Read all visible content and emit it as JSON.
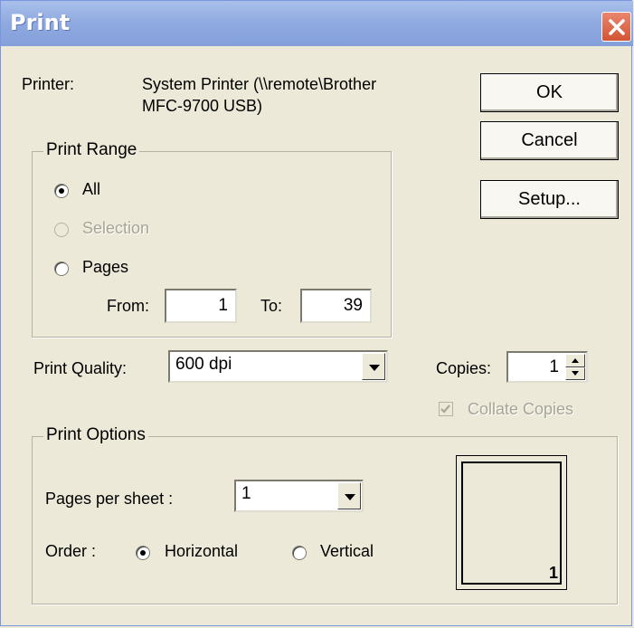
{
  "window": {
    "title": "Print"
  },
  "printer": {
    "label": "Printer:",
    "name_line1": "System Printer (\\\\remote\\Brother",
    "name_line2": "MFC-9700 USB)"
  },
  "buttons": {
    "ok": "OK",
    "cancel": "Cancel",
    "setup": "Setup..."
  },
  "print_range": {
    "legend": "Print Range",
    "options": [
      {
        "label": "All",
        "checked": true,
        "enabled": true
      },
      {
        "label": "Selection",
        "checked": false,
        "enabled": false
      },
      {
        "label": "Pages",
        "checked": false,
        "enabled": true
      }
    ],
    "from_label": "From:",
    "from_value": "1",
    "to_label": "To:",
    "to_value": "39"
  },
  "print_quality": {
    "label": "Print Quality:",
    "value": "600 dpi"
  },
  "copies": {
    "label": "Copies:",
    "value": "1"
  },
  "collate": {
    "label": "Collate Copies",
    "checked": true,
    "enabled": false
  },
  "print_options": {
    "legend": "Print Options",
    "pages_per_sheet_label": "Pages per sheet :",
    "pages_per_sheet_value": "1",
    "order_label": "Order :",
    "order_options": [
      {
        "label": "Horizontal",
        "checked": true
      },
      {
        "label": "Vertical",
        "checked": false
      }
    ],
    "preview_page_number": "1"
  }
}
